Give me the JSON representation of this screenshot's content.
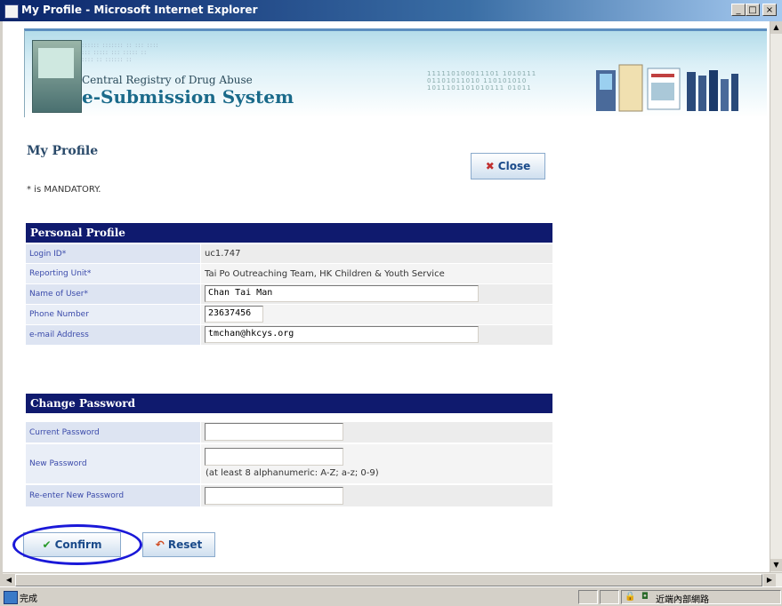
{
  "window": {
    "title": "My Profile - Microsoft Internet Explorer",
    "minimize": "_",
    "maximize": "□",
    "close": "×"
  },
  "banner": {
    "registry": "Central Registry of Drug Abuse",
    "system": "e-Submission System"
  },
  "page": {
    "title": "My Profile",
    "mandatory_note": "* is MANDATORY.",
    "close_label": "Close",
    "close_icon": "close-x-icon"
  },
  "personal_profile": {
    "heading": "Personal Profile",
    "rows": [
      {
        "label": "Login ID*",
        "value": "uc1.747"
      },
      {
        "label": "Reporting Unit*",
        "value": "Tai Po Outreaching Team, HK Children & Youth Service"
      },
      {
        "label": "Name of User*",
        "value": "Chan Tai Man"
      },
      {
        "label": "Phone Number",
        "value": "23637456"
      },
      {
        "label": "e-mail Address",
        "value": "tmchan@hkcys.org"
      }
    ]
  },
  "change_password": {
    "heading": "Change Password",
    "current_label": "Current Password",
    "new_label": "New Password",
    "new_hint": "(at least 8 alphanumeric: A-Z; a-z; 0-9)",
    "reenter_label": "Re-enter New Password",
    "current_value": "",
    "new_value": "",
    "reenter_value": ""
  },
  "actions": {
    "confirm_label": "Confirm",
    "reset_label": "Reset",
    "confirm_icon": "check-icon",
    "reset_icon": "reset-arrow-icon"
  },
  "status_bar": {
    "status_text": "完成",
    "zone_text": "近端內部網路"
  },
  "colors": {
    "section_header": "#0f1a6e",
    "label_text": "#3a4aaa",
    "highlight_ring": "#1a18d8"
  }
}
